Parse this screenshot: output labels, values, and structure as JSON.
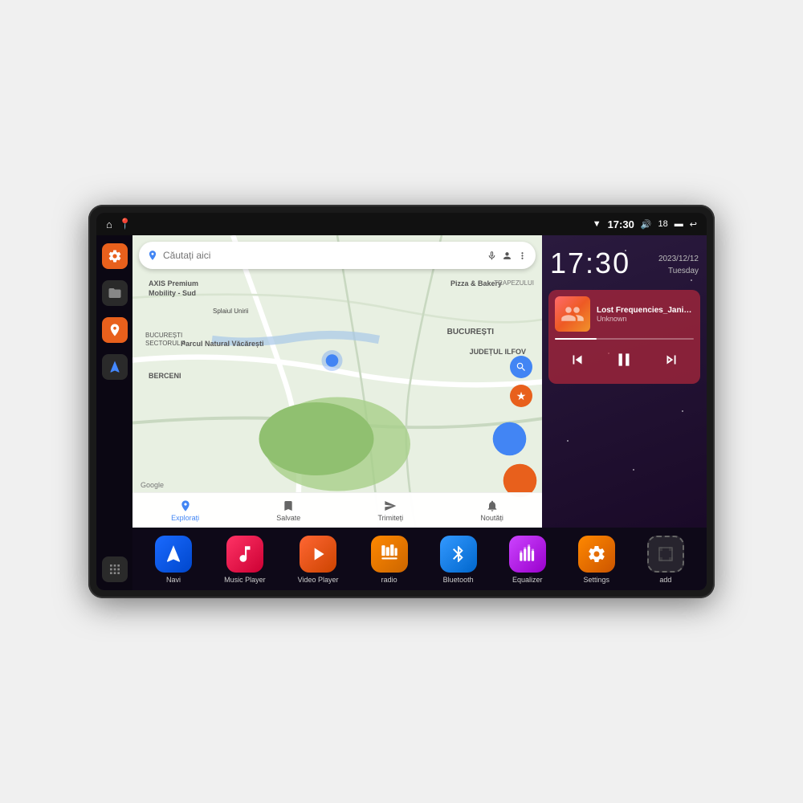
{
  "device": {
    "statusBar": {
      "time": "17:30",
      "battery": "18",
      "leftIcons": [
        "home",
        "maps"
      ]
    },
    "clock": {
      "time": "17:30",
      "date": "2023/12/12",
      "day": "Tuesday"
    },
    "music": {
      "title": "Lost Frequencies_Janie...",
      "artist": "Unknown",
      "progress": 30
    },
    "map": {
      "searchPlaceholder": "Căutați aici",
      "locations": [
        "AXIS Premium Mobility - Sud",
        "Pizza & Bakery",
        "Parcul Natural Văcărești",
        "BUCUREȘTI SECTORUL 4",
        "BUCUREȘTI",
        "JUDEȚUL ILFOV",
        "BERCENI",
        "TRAPEZULUI"
      ],
      "tabs": [
        "Explorați",
        "Salvate",
        "Trimiteți",
        "Noutăți"
      ]
    },
    "apps": [
      {
        "id": "navi",
        "label": "Navi",
        "iconClass": "icon-navi"
      },
      {
        "id": "music-player",
        "label": "Music Player",
        "iconClass": "icon-music"
      },
      {
        "id": "video-player",
        "label": "Video Player",
        "iconClass": "icon-video"
      },
      {
        "id": "radio",
        "label": "radio",
        "iconClass": "icon-radio"
      },
      {
        "id": "bluetooth",
        "label": "Bluetooth",
        "iconClass": "icon-bluetooth"
      },
      {
        "id": "equalizer",
        "label": "Equalizer",
        "iconClass": "icon-eq"
      },
      {
        "id": "settings",
        "label": "Settings",
        "iconClass": "icon-settings"
      },
      {
        "id": "add",
        "label": "add",
        "iconClass": "icon-add"
      }
    ]
  }
}
